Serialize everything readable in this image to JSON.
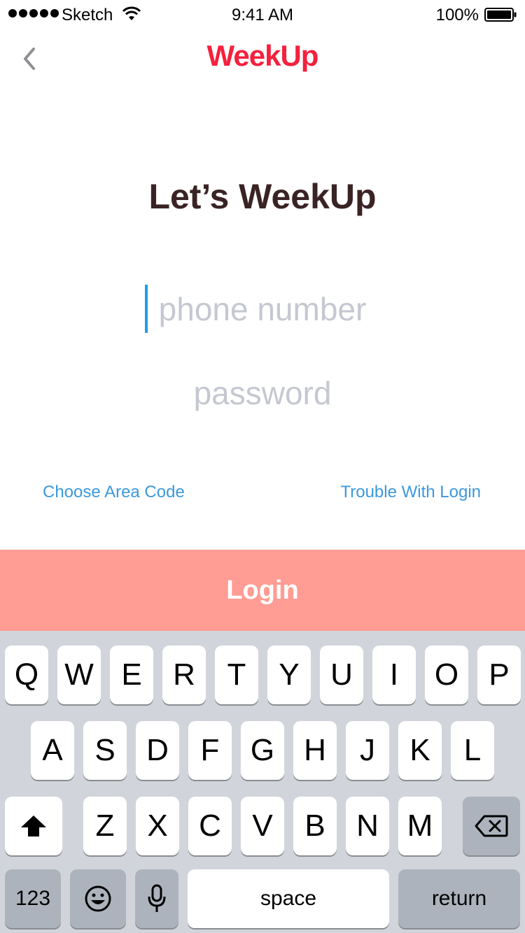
{
  "status_bar": {
    "carrier": "Sketch",
    "time": "9:41 AM",
    "battery": "100%"
  },
  "header": {
    "brand": "WeekUp"
  },
  "main": {
    "headline": "Let’s WeekUp",
    "phone_placeholder": "phone number",
    "password_placeholder": "password",
    "area_code_link": "Choose Area Code",
    "trouble_link": "Trouble With Login",
    "login_label": "Login"
  },
  "keyboard": {
    "row1": [
      "Q",
      "W",
      "E",
      "R",
      "T",
      "Y",
      "U",
      "I",
      "O",
      "P"
    ],
    "row2": [
      "A",
      "S",
      "D",
      "F",
      "G",
      "H",
      "J",
      "K",
      "L"
    ],
    "row3": [
      "Z",
      "X",
      "C",
      "V",
      "B",
      "N",
      "M"
    ],
    "numbers_label": "123",
    "space_label": "space",
    "return_label": "return"
  },
  "colors": {
    "brand": "#F5213D",
    "login_bg": "#FF9C93",
    "link": "#3C99DC",
    "headline": "#3A2325"
  }
}
